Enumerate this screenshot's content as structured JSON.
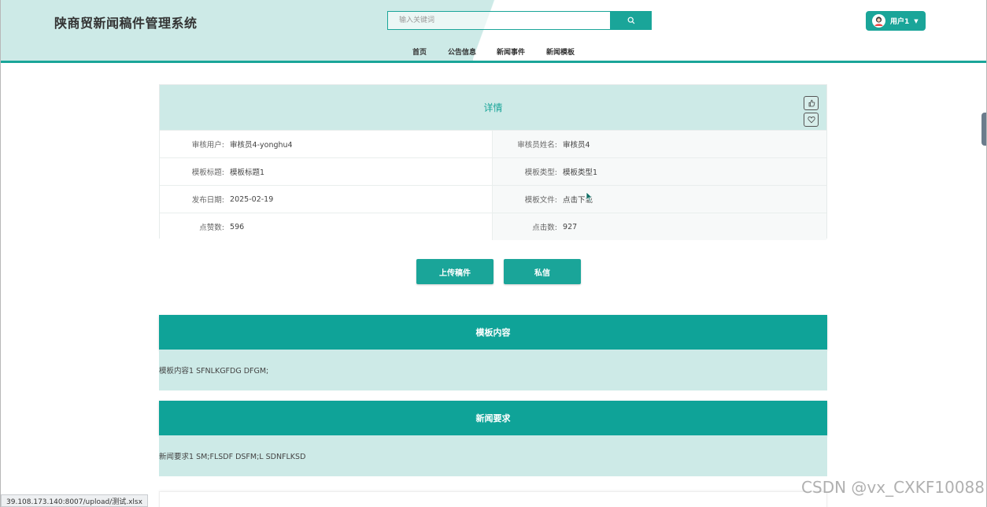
{
  "header": {
    "title": "陕商贸新闻稿件管理系统",
    "search_placeholder": "输入关键词",
    "user_label": "用户1",
    "nav": [
      "首页",
      "公告信息",
      "新闻事件",
      "新闻模板"
    ]
  },
  "detail": {
    "title": "详情",
    "fields": [
      {
        "label": "审核用户:",
        "value": "审核员4-yonghu4",
        "label2": "审核员姓名:",
        "value2": "审核员4"
      },
      {
        "label": "模板标题:",
        "value": "模板标题1",
        "label2": "模板类型:",
        "value2": "模板类型1"
      },
      {
        "label": "发布日期:",
        "value": "2025-02-19",
        "label2": "模板文件:",
        "value2": "点击下载"
      },
      {
        "label": "点赞数:",
        "value": "596",
        "label2": "点击数:",
        "value2": "927"
      }
    ]
  },
  "actions": {
    "upload": "上传稿件",
    "message": "私信"
  },
  "sections": [
    {
      "title": "模板内容",
      "body": "模板内容1 SFNLKGFDG DFGM;"
    },
    {
      "title": "新闻要求",
      "body": "新闻要求1 SM;FLSDF DSFM;L SDNFLKSD"
    }
  ],
  "status_url": "39.108.173.140:8007/upload/测试.xlsx",
  "watermark": "CSDN @vx_CXKF10088",
  "colors": {
    "accent": "#1aa599",
    "light": "#cdeae7",
    "link": "#1e8ed6"
  }
}
